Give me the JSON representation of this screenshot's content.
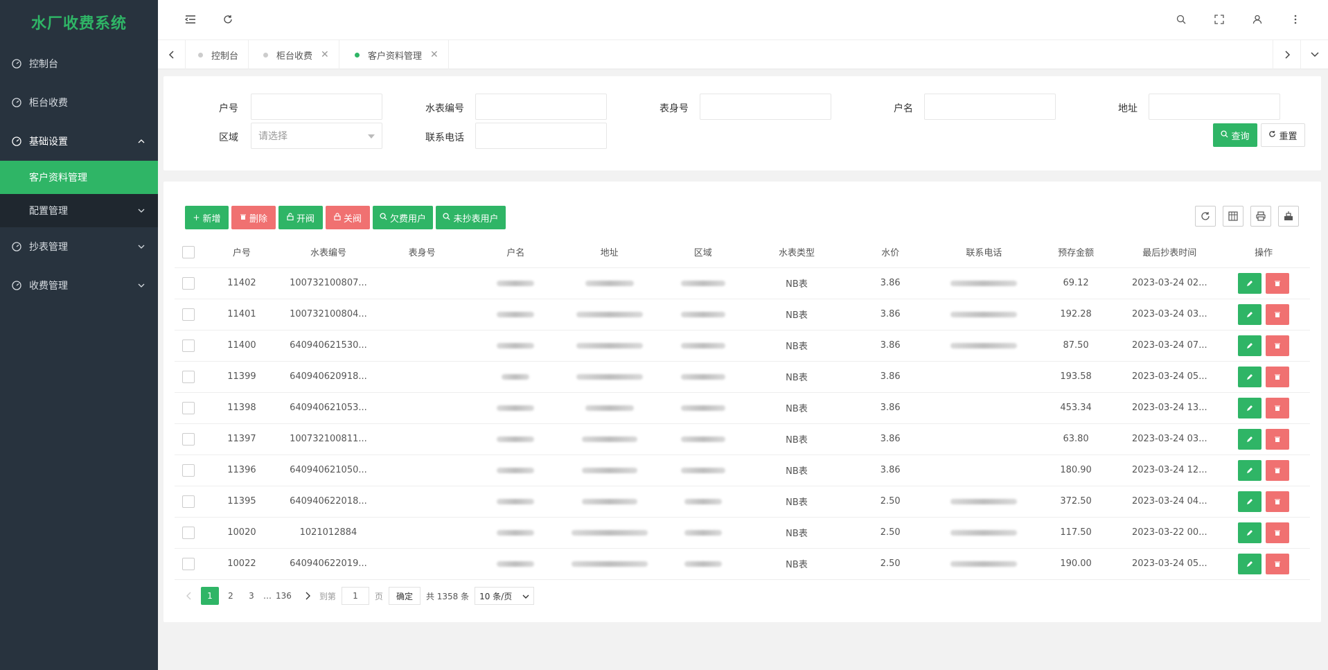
{
  "app": {
    "title": "水厂收费系统"
  },
  "sidebar": {
    "items": [
      {
        "label": "控制台",
        "icon": "dashboard-icon"
      },
      {
        "label": "柜台收费",
        "icon": "dashboard-icon"
      },
      {
        "label": "基础设置",
        "icon": "dashboard-icon"
      },
      {
        "label": "客户资料管理"
      },
      {
        "label": "配置管理"
      },
      {
        "label": "抄表管理",
        "icon": "dashboard-icon"
      },
      {
        "label": "收费管理",
        "icon": "dashboard-icon"
      }
    ]
  },
  "tabs": [
    {
      "label": "控制台"
    },
    {
      "label": "柜台收费"
    },
    {
      "label": "客户资料管理"
    }
  ],
  "search": {
    "labels": {
      "account": "户号",
      "meter_no": "水表编号",
      "body_no": "表身号",
      "name": "户名",
      "address": "地址",
      "region": "区域",
      "phone": "联系电话"
    },
    "region_placeholder": "请选择",
    "query_label": "查询",
    "reset_label": "重置"
  },
  "toolbar": {
    "add": "新增",
    "delete": "删除",
    "open_valve": "开阀",
    "close_valve": "关阀",
    "arrears": "欠费用户",
    "unread": "未抄表用户"
  },
  "table": {
    "columns": [
      "户号",
      "水表编号",
      "表身号",
      "户名",
      "地址",
      "区域",
      "水表类型",
      "水价",
      "联系电话",
      "预存金额",
      "最后抄表时间",
      "操作"
    ],
    "rows": [
      {
        "account": "11402",
        "meter": "100732100807...",
        "type": "NB表",
        "price": "3.86",
        "balance": "69.12",
        "last": "2023-03-24 02..."
      },
      {
        "account": "11401",
        "meter": "100732100804...",
        "type": "NB表",
        "price": "3.86",
        "balance": "192.28",
        "last": "2023-03-24 03..."
      },
      {
        "account": "11400",
        "meter": "640940621530...",
        "type": "NB表",
        "price": "3.86",
        "balance": "87.50",
        "last": "2023-03-24 07..."
      },
      {
        "account": "11399",
        "meter": "640940620918...",
        "type": "NB表",
        "price": "3.86",
        "balance": "193.58",
        "last": "2023-03-24 05..."
      },
      {
        "account": "11398",
        "meter": "640940621053...",
        "type": "NB表",
        "price": "3.86",
        "balance": "453.34",
        "last": "2023-03-24 13..."
      },
      {
        "account": "11397",
        "meter": "100732100811...",
        "type": "NB表",
        "price": "3.86",
        "balance": "63.80",
        "last": "2023-03-24 03..."
      },
      {
        "account": "11396",
        "meter": "640940621050...",
        "type": "NB表",
        "price": "3.86",
        "balance": "180.90",
        "last": "2023-03-24 12..."
      },
      {
        "account": "11395",
        "meter": "640940622018...",
        "type": "NB表",
        "price": "2.50",
        "balance": "372.50",
        "last": "2023-03-24 04..."
      },
      {
        "account": "10020",
        "meter": "1021012884",
        "type": "NB表",
        "price": "2.50",
        "balance": "117.50",
        "last": "2023-03-22 00..."
      },
      {
        "account": "10022",
        "meter": "640940622019...",
        "type": "NB表",
        "price": "2.50",
        "balance": "190.00",
        "last": "2023-03-24 05..."
      }
    ]
  },
  "pagination": {
    "pages": [
      "1",
      "2",
      "3"
    ],
    "ellipsis": "…",
    "last_page": "136",
    "goto_label": "到第",
    "goto_value": "1",
    "page_unit": "页",
    "confirm": "确定",
    "total": "共 1358 条",
    "page_size": "10 条/页"
  },
  "colors": {
    "accent": "#2fb566",
    "danger": "#f07171",
    "sidebar_bg": "#28333e"
  }
}
